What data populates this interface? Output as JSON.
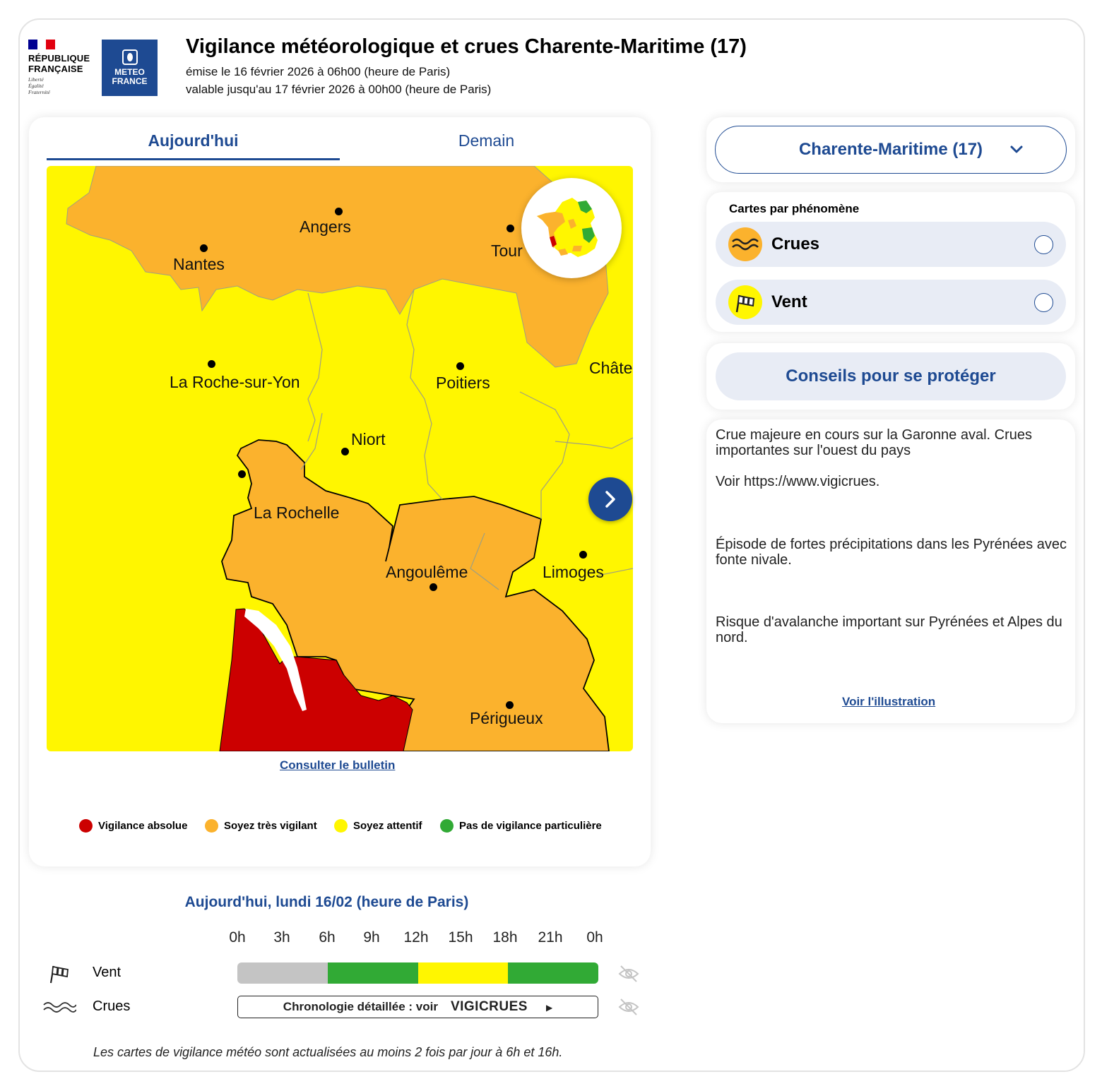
{
  "header": {
    "rf_name_line1": "RÉPUBLIQUE",
    "rf_name_line2": "FRANÇAISE",
    "rf_motto1": "Liberté",
    "rf_motto2": "Égalité",
    "rf_motto3": "Fraternité",
    "mf_line1": "METEO",
    "mf_line2": "FRANCE",
    "title": "Vigilance météorologique et crues Charente-Maritime (17)",
    "issued": "émise le 16 février 2026 à 06h00 (heure de Paris)",
    "valid": "valable jusqu'au 17 février 2026 à 00h00 (heure de Paris)"
  },
  "tabs": {
    "today": "Aujourd'hui",
    "tomorrow": "Demain"
  },
  "map": {
    "cities": [
      "Nantes",
      "Angers",
      "Tour",
      "La Roche-sur-Yon",
      "Poitiers",
      "Châte",
      "Niort",
      "La Rochelle",
      "Angoulême",
      "Limoges",
      "Périgueux"
    ],
    "bulletin_link": "Consulter le bulletin"
  },
  "legend": [
    {
      "label": "Vigilance absolue",
      "color": "#cc0000"
    },
    {
      "label": "Soyez très vigilant",
      "color": "#fbb22d"
    },
    {
      "label": "Soyez attentif",
      "color": "#fff600"
    },
    {
      "label": "Pas de vigilance particulière",
      "color": "#31aa35"
    }
  ],
  "department_select": "Charente-Maritime (17)",
  "phenomena": {
    "title": "Cartes par phénomène",
    "items": [
      {
        "label": "Crues",
        "color": "#fbb22d"
      },
      {
        "label": "Vent",
        "color": "#fff600"
      }
    ]
  },
  "conseils": "Conseils pour se protéger",
  "description": {
    "p1": "Crue majeure en cours sur la Garonne aval. Crues importantes sur l'ouest du pays",
    "p2": "Voir https://www.vigicrues.",
    "p3": "Épisode de fortes précipitations dans les Pyrénées avec fonte nivale.",
    "p4": "Risque d'avalanche important sur Pyrénées et Alpes du nord.",
    "illustration_link": "Voir l'illustration"
  },
  "timeline": {
    "title": "Aujourd'hui, lundi 16/02 (heure de Paris)",
    "hours": [
      "0h",
      "3h",
      "6h",
      "9h",
      "12h",
      "15h",
      "18h",
      "21h",
      "0h"
    ],
    "vent_label": "Vent",
    "vent_segments": [
      {
        "from": "0h",
        "to": "6h",
        "color": "#c4c4c4"
      },
      {
        "from": "6h",
        "to": "12h",
        "color": "#31aa35"
      },
      {
        "from": "12h",
        "to": "18h",
        "color": "#fff600"
      },
      {
        "from": "18h",
        "to": "0h",
        "color": "#31aa35"
      }
    ],
    "crues_label": "Crues",
    "crues_text": "Chronologie détaillée : voir",
    "vigicrues": "VIGICRUES"
  },
  "footnote": "Les cartes de vigilance météo sont actualisées au moins 2 fois par jour à 6h et 16h."
}
